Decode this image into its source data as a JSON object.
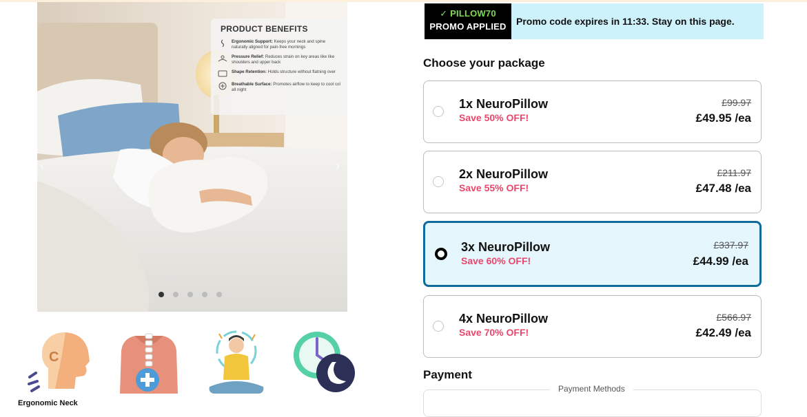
{
  "gallery": {
    "benefits_title": "PRODUCT BENEFITS",
    "benefits": [
      {
        "icon": "spine-icon",
        "title": "Ergonomic Support:",
        "text": "Keeps your neck and spine naturally aligned for pain-free mornings"
      },
      {
        "icon": "pressure-icon",
        "title": "Pressure Relief:",
        "text": "Reduces strain on key areas like like shoulders and upper back"
      },
      {
        "icon": "pillow-shape-icon",
        "title": "Shape Retention:",
        "text": "Holds structure without flatning over"
      },
      {
        "icon": "airflow-icon",
        "title": "Breathable Surface:",
        "text": "Promotes airflow to keep to cool col all night"
      }
    ],
    "dot_count": 5,
    "active_dot": 0
  },
  "features": [
    {
      "icon": "ergonomic-neck-icon",
      "label": "Ergonomic Neck"
    },
    {
      "icon": "back-spine-icon",
      "label": ""
    },
    {
      "icon": "meditation-icon",
      "label": ""
    },
    {
      "icon": "sleep-clock-icon",
      "label": ""
    }
  ],
  "promo": {
    "code": "✓ PILLOW70",
    "applied": "PROMO APPLIED",
    "message": "Promo code expires in 11:33. Stay on this page."
  },
  "packages_title": "Choose your package",
  "packages": [
    {
      "name": "1x NeuroPillow",
      "save": "Save 50% OFF!",
      "old_price": "£99.97",
      "price": "£49.95 /ea",
      "selected": false
    },
    {
      "name": "2x NeuroPillow",
      "save": "Save 55% OFF!",
      "old_price": "£211.97",
      "price": "£47.48 /ea",
      "selected": false
    },
    {
      "name": "3x NeuroPillow",
      "save": "Save 60% OFF!",
      "old_price": "£337.97",
      "price": "£44.99 /ea",
      "selected": true
    },
    {
      "name": "4x NeuroPillow",
      "save": "Save 70% OFF!",
      "old_price": "£566.97",
      "price": "£42.49 /ea",
      "selected": false
    }
  ],
  "payment": {
    "title": "Payment",
    "methods_label": "Payment Methods"
  },
  "colors": {
    "accent_blue": "#0e6b9a",
    "save_pink": "#e8466b",
    "promo_green": "#7ed957",
    "promo_bg": "#cef2fb"
  }
}
